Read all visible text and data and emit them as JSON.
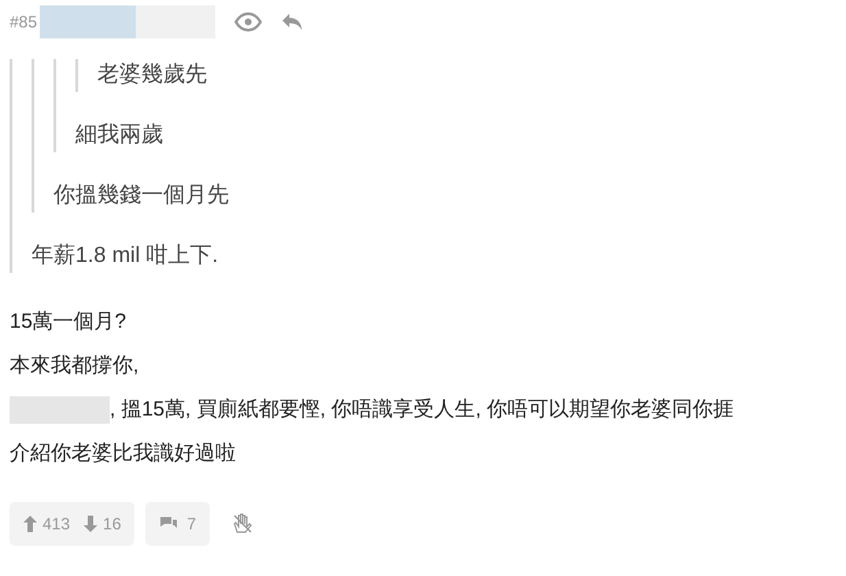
{
  "post": {
    "number": "#85"
  },
  "quote": {
    "text": "年薪1.8 mil 咁上下.",
    "quote": {
      "text": "你搵幾錢一個月先",
      "quote": {
        "text": "細我兩歲",
        "quote": {
          "text": "老婆幾歲先"
        }
      }
    }
  },
  "body": [
    {
      "kind": "text",
      "text": "15萬一個月?"
    },
    {
      "kind": "text",
      "text": "本來我都撐你,"
    },
    {
      "kind": "redacted",
      "text": ", 搵15萬, 買廁紙都要慳, 你唔識享受人生, 你唔可以期望你老婆同你捱"
    },
    {
      "kind": "text",
      "text": "介紹你老婆比我識好過啦"
    }
  ],
  "footer": {
    "upvotes": "413",
    "downvotes": "16",
    "comments": "7"
  }
}
